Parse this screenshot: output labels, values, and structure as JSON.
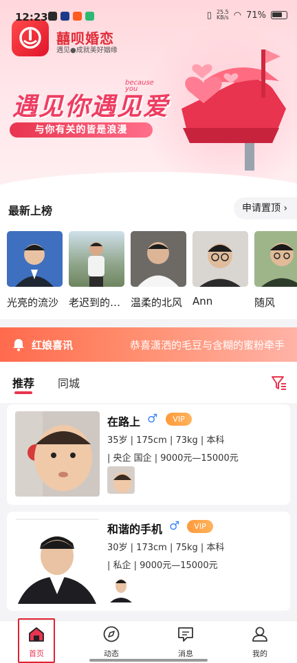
{
  "status_bar": {
    "time": "12:23",
    "net_speed_top": "25.5",
    "net_speed_unit": "KB/s",
    "battery": "71%"
  },
  "header": {
    "app_name": "囍呗婚恋",
    "app_tagline": "遇见●成就美好姻缘"
  },
  "banner": {
    "slogan": "遇见你遇见爱",
    "because_text": "because you",
    "tagline": "与你有关的皆是浪漫"
  },
  "latest": {
    "title": "最新上榜",
    "apply_label": "申请置顶",
    "items": [
      {
        "name": "光亮的流沙"
      },
      {
        "name": "老迟到的…"
      },
      {
        "name": "温柔的北风"
      },
      {
        "name": "Ann"
      },
      {
        "name": "随风"
      }
    ]
  },
  "notice": {
    "label": "红娘喜讯",
    "message": "恭喜潇洒的毛豆与含糊的蜜粉牵手"
  },
  "tabs": [
    {
      "label": "推荐"
    },
    {
      "label": "同城"
    }
  ],
  "cards": [
    {
      "nickname": "在路上",
      "gender": "♂",
      "vip": "VIP",
      "line1": "35岁 | 175cm | 73kg | 本科",
      "line2": "| 央企 国企 | 9000元—15000元"
    },
    {
      "nickname": "和谐的手机",
      "gender": "♂",
      "vip": "VIP",
      "line1": "30岁 | 173cm | 75kg | 本科",
      "line2": "| 私企 | 9000元—15000元"
    }
  ],
  "bottom_nav": [
    {
      "label": "首页",
      "icon": "home-icon"
    },
    {
      "label": "动态",
      "icon": "compass-icon"
    },
    {
      "label": "消息",
      "icon": "message-icon"
    },
    {
      "label": "我的",
      "icon": "user-icon"
    }
  ],
  "colors": {
    "brand": "#e8344f",
    "notice": "#ff6a4d",
    "male": "#3b86f5",
    "vip": "#ff9a3c"
  }
}
